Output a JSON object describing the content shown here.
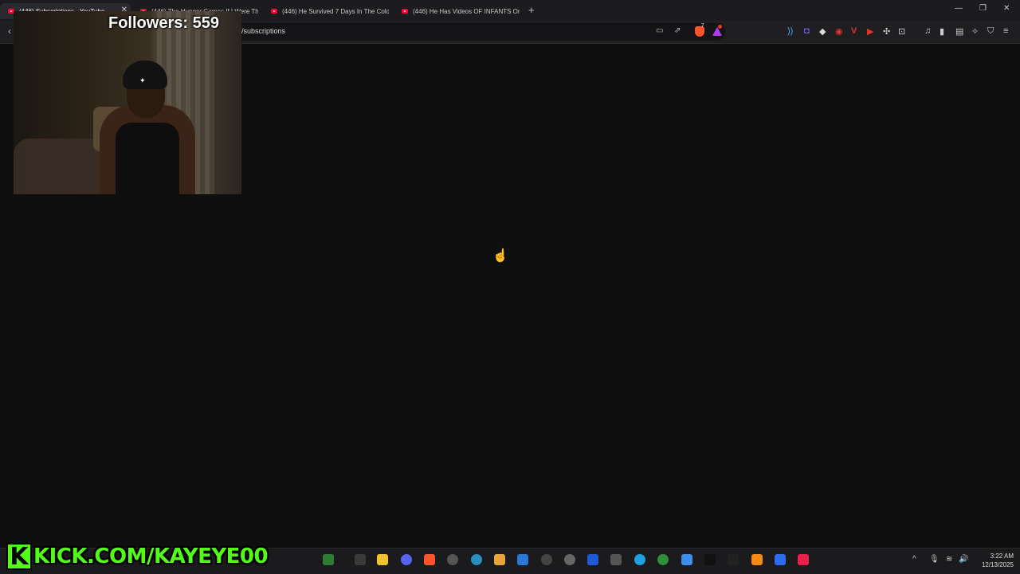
{
  "browser": {
    "tabs": [
      {
        "title": "(446) Subscriptions - YouTube",
        "active": true
      },
      {
        "title": "(446) The Hunger Games If I Were Th",
        "active": false
      },
      {
        "title": "(446) He Survived 7 Days In The Cold",
        "active": false
      },
      {
        "title": "(446) He Has Videos OF INFANTS On",
        "active": false
      }
    ],
    "new_tab": "+",
    "window_controls": {
      "minimize": "—",
      "restore": "❐",
      "close": "✕"
    },
    "address": {
      "url": "/subscriptions"
    },
    "brave_badge": "7",
    "back": "‹"
  },
  "overlay": {
    "followers": "Followers: 559",
    "kick_letter": "K",
    "kick_url": "KICK.COM/KAYEYE00"
  },
  "taskbar": {
    "time": "3:22 AM",
    "date": "12/13/2025",
    "tray": {
      "chevron": "^",
      "mic": "🎙",
      "wifi": "≋",
      "volume": "🔊"
    }
  },
  "colors": {
    "page_bg": "#0f0f0f",
    "kick_green": "#53fc18",
    "youtube_red": "#ff0033",
    "brave_orange": "#fb542b"
  }
}
